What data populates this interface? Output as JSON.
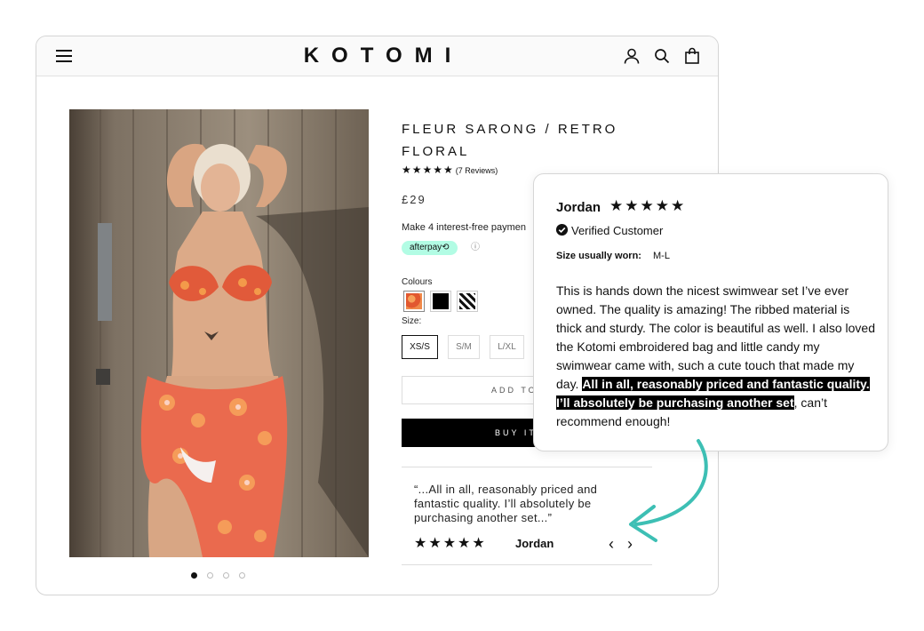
{
  "header": {
    "logo": "KOTOMI",
    "icons": [
      "menu-icon",
      "account-icon",
      "search-icon",
      "bag-icon"
    ]
  },
  "gallery": {
    "slide_count": 4,
    "active_slide": 1
  },
  "product": {
    "title": "FLEUR SARONG / RETRO FLORAL",
    "stars": "★★★★★",
    "reviews_label": "(7 Reviews)",
    "price": "£29",
    "installments_text": "Make 4 interest-free paymen",
    "afterpay_label": "afterpay⟲",
    "colours_label": "Colours",
    "colours": [
      {
        "name": "retro-floral",
        "hex": "#e2582f",
        "selected": true
      },
      {
        "name": "black",
        "hex": "#000000",
        "selected": false
      },
      {
        "name": "zebra",
        "hex": "#555555",
        "selected": false
      }
    ],
    "size_label": "Size:",
    "sizes": [
      {
        "label": "XS/S",
        "selected": true
      },
      {
        "label": "S/M",
        "selected": false
      },
      {
        "label": "L/XL",
        "selected": false
      }
    ],
    "add_to_cart_label": "ADD TO",
    "buy_now_label": "BUY IT"
  },
  "quote": {
    "text": "“...All in all, reasonably priced and fantastic quality. I’ll absolutely be purchasing another set...”",
    "stars": "★★★★★",
    "author": "Jordan",
    "prev": "‹",
    "next": "›"
  },
  "review_card": {
    "name": "Jordan",
    "stars": "★★★★★",
    "verified": "Verified Customer",
    "size_label": "Size usually worn:",
    "size_value": "M-L",
    "body_plain": "This is hands down the nicest swimwear set I’ve ever owned. The quality is amazing! The ribbed material is thick and sturdy. The color is beautiful as well. I also loved the Kotomi embroidered bag and little candy my swimwear came with, such a cute touch that made my day. ",
    "body_highlight": "All in all, reasonably priced and fantastic quality. I’ll absolutely be purchasing another set",
    "body_end": ", can’t recommend enough!"
  },
  "colors": {
    "accent_teal": "#3dbfb4",
    "afterpay_mint": "#b2fce4"
  }
}
